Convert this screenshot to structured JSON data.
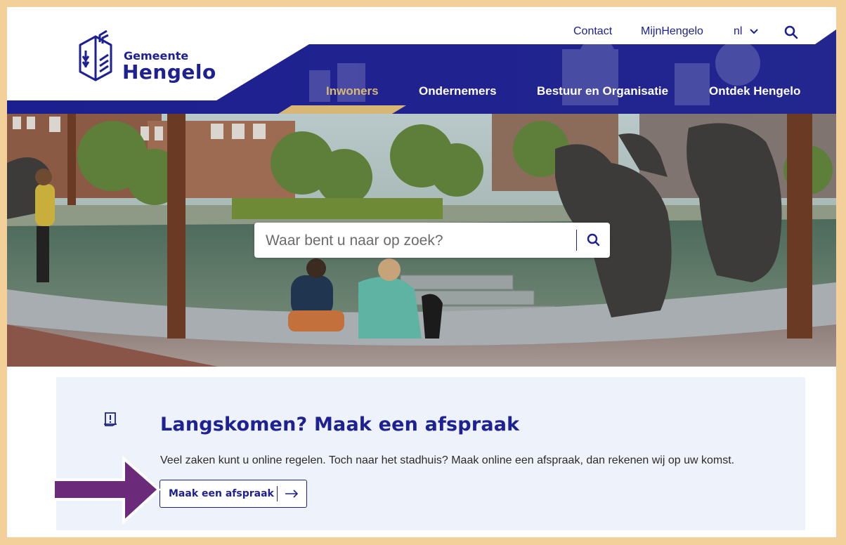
{
  "header": {
    "logo": {
      "line1": "Gemeente",
      "line2": "Hengelo"
    },
    "utility": {
      "contact": "Contact",
      "mijn": "MijnHengelo",
      "language": "nl"
    },
    "nav": [
      {
        "label": "Inwoners",
        "active": true
      },
      {
        "label": "Ondernemers",
        "active": false
      },
      {
        "label": "Bestuur en Organisatie",
        "active": false
      },
      {
        "label": "Ontdek Hengelo",
        "active": false
      }
    ]
  },
  "hero": {
    "search_placeholder": "Waar bent u naar op zoek?",
    "search_icon": "search-icon"
  },
  "appointment": {
    "icon": "appointment-icon",
    "title": "Langskomen? Maak een afspraak",
    "text": "Veel zaken kunt u online regelen. Toch naar het stadhuis? Maak online een afspraak, dan rekenen wij op uw komst.",
    "button_label": "Maak een afspraak"
  },
  "colors": {
    "brand": "#1e2191",
    "accent": "#d8b776",
    "frame": "#f3cf9a",
    "card_bg": "#eef2fb",
    "annotation_arrow": "#6b2a7a"
  }
}
